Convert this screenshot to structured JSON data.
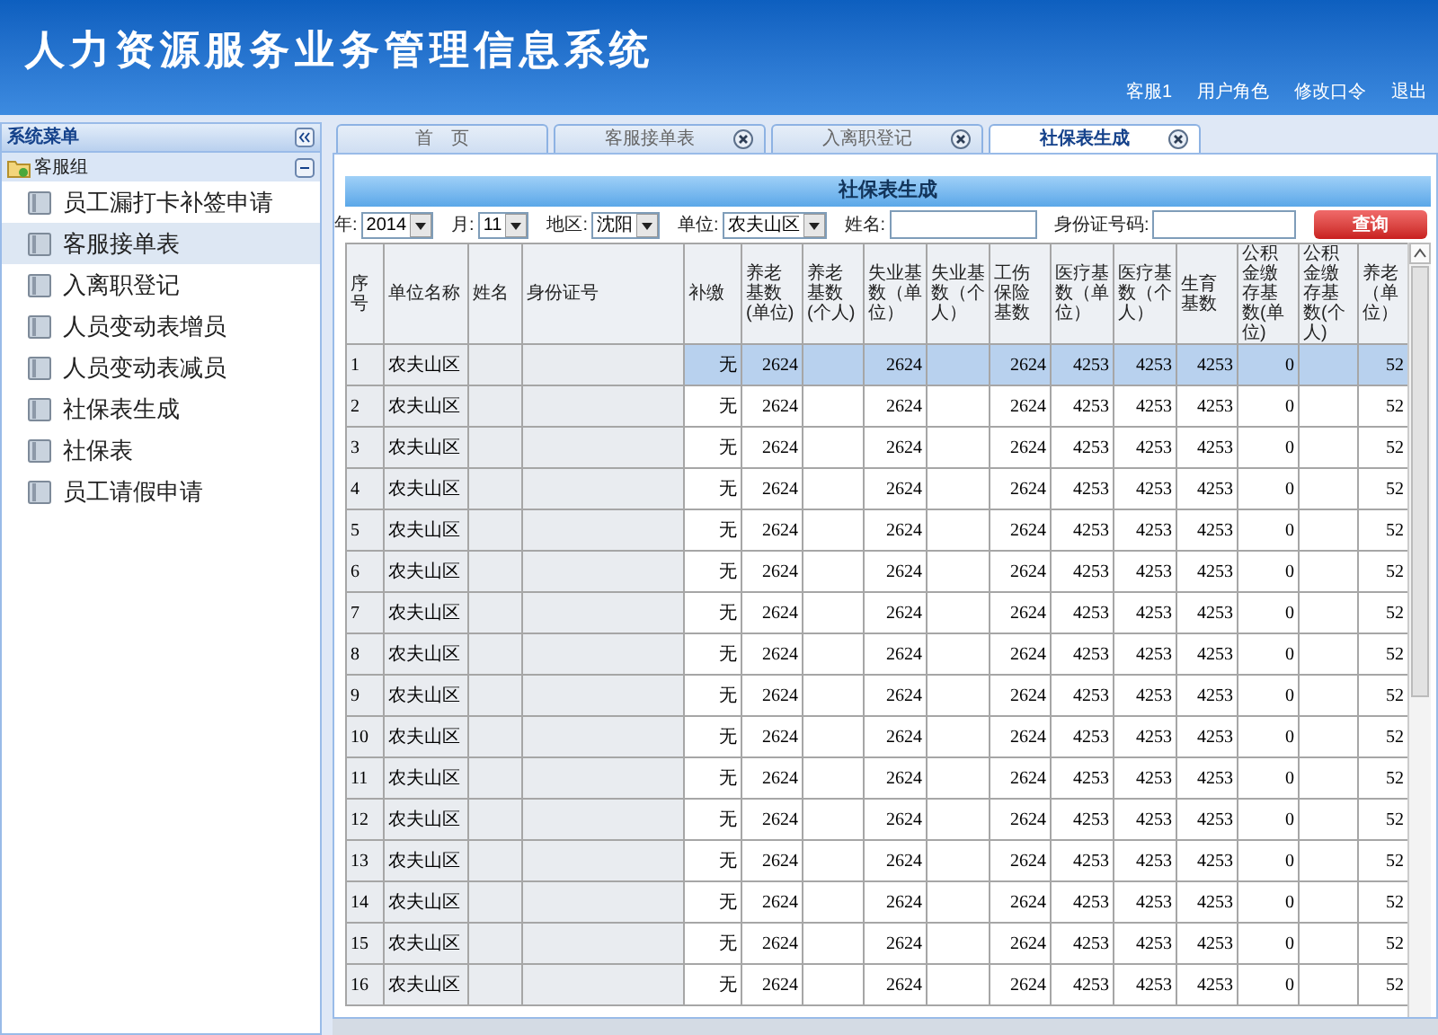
{
  "header": {
    "title": "人力资源服务业务管理信息系统",
    "links": [
      "客服1",
      "用户角色",
      "修改口令",
      "退出"
    ]
  },
  "sidebar": {
    "title": "系统菜单",
    "group": {
      "label": "客服组",
      "expanded": true,
      "items": [
        {
          "label": "员工漏打卡补签申请",
          "selected": false
        },
        {
          "label": "客服接单表",
          "selected": true
        },
        {
          "label": "入离职登记",
          "selected": false
        },
        {
          "label": "人员变动表增员",
          "selected": false
        },
        {
          "label": "人员变动表减员",
          "selected": false
        },
        {
          "label": "社保表生成",
          "selected": false
        },
        {
          "label": "社保表",
          "selected": false
        },
        {
          "label": "员工请假申请",
          "selected": false
        }
      ]
    }
  },
  "tabs": [
    {
      "label": "首　页",
      "selected": false,
      "closable": false
    },
    {
      "label": "客服接单表",
      "selected": false,
      "closable": true
    },
    {
      "label": "入离职登记",
      "selected": false,
      "closable": true
    },
    {
      "label": "社保表生成",
      "selected": true,
      "closable": true
    }
  ],
  "panel": {
    "title": "社保表生成",
    "filters": [
      {
        "kind": "select",
        "label": "年:",
        "value": "2014"
      },
      {
        "kind": "select",
        "label": "月:",
        "value": "11"
      },
      {
        "kind": "select",
        "label": "地区:",
        "value": "沈阳"
      },
      {
        "kind": "select",
        "label": "单位:",
        "value": "农夫山区"
      },
      {
        "kind": "input",
        "label": "姓名:"
      },
      {
        "kind": "input",
        "label": "身份证号码:"
      }
    ],
    "search_button": "查询"
  },
  "table": {
    "columns": [
      {
        "label": "序号",
        "kind": "index"
      },
      {
        "label": "单位名称",
        "kind": "label"
      },
      {
        "label": "姓名",
        "kind": "label"
      },
      {
        "label": "身份证号",
        "kind": "label"
      },
      {
        "label": "补缴",
        "kind": "flag"
      },
      {
        "label": "养老基数(单位)",
        "kind": "number"
      },
      {
        "label": "养老基数(个人)",
        "kind": "number"
      },
      {
        "label": "失业基数（单位）",
        "kind": "number"
      },
      {
        "label": "失业基数（个人）",
        "kind": "number"
      },
      {
        "label": "工伤保险基数",
        "kind": "number"
      },
      {
        "label": "医疗基数（单位）",
        "kind": "number"
      },
      {
        "label": "医疗基数（个人）",
        "kind": "number"
      },
      {
        "label": "生育基数",
        "kind": "number"
      },
      {
        "label": "公积金缴存基数(单位)",
        "kind": "number"
      },
      {
        "label": "公积金缴存基数(个人)",
        "kind": "number"
      },
      {
        "label": "养老（单位）",
        "kind": "number"
      }
    ],
    "rows": [
      {
        "selected": true,
        "cells": [
          "1",
          "农夫山区",
          null,
          null,
          "无",
          "2624",
          null,
          "2624",
          null,
          "2624",
          "4253",
          "4253",
          "4253",
          "0",
          null,
          "52"
        ]
      },
      {
        "selected": false,
        "cells": [
          "2",
          "农夫山区",
          null,
          null,
          "无",
          "2624",
          null,
          "2624",
          null,
          "2624",
          "4253",
          "4253",
          "4253",
          "0",
          null,
          "52"
        ]
      },
      {
        "selected": false,
        "cells": [
          "3",
          "农夫山区",
          null,
          null,
          "无",
          "2624",
          null,
          "2624",
          null,
          "2624",
          "4253",
          "4253",
          "4253",
          "0",
          null,
          "52"
        ]
      },
      {
        "selected": false,
        "cells": [
          "4",
          "农夫山区",
          null,
          null,
          "无",
          "2624",
          null,
          "2624",
          null,
          "2624",
          "4253",
          "4253",
          "4253",
          "0",
          null,
          "52"
        ]
      },
      {
        "selected": false,
        "cells": [
          "5",
          "农夫山区",
          null,
          null,
          "无",
          "2624",
          null,
          "2624",
          null,
          "2624",
          "4253",
          "4253",
          "4253",
          "0",
          null,
          "52"
        ]
      },
      {
        "selected": false,
        "cells": [
          "6",
          "农夫山区",
          null,
          null,
          "无",
          "2624",
          null,
          "2624",
          null,
          "2624",
          "4253",
          "4253",
          "4253",
          "0",
          null,
          "52"
        ]
      },
      {
        "selected": false,
        "cells": [
          "7",
          "农夫山区",
          null,
          null,
          "无",
          "2624",
          null,
          "2624",
          null,
          "2624",
          "4253",
          "4253",
          "4253",
          "0",
          null,
          "52"
        ]
      },
      {
        "selected": false,
        "cells": [
          "8",
          "农夫山区",
          null,
          null,
          "无",
          "2624",
          null,
          "2624",
          null,
          "2624",
          "4253",
          "4253",
          "4253",
          "0",
          null,
          "52"
        ]
      },
      {
        "selected": false,
        "cells": [
          "9",
          "农夫山区",
          null,
          null,
          "无",
          "2624",
          null,
          "2624",
          null,
          "2624",
          "4253",
          "4253",
          "4253",
          "0",
          null,
          "52"
        ]
      },
      {
        "selected": false,
        "cells": [
          "10",
          "农夫山区",
          null,
          null,
          "无",
          "2624",
          null,
          "2624",
          null,
          "2624",
          "4253",
          "4253",
          "4253",
          "0",
          null,
          "52"
        ]
      },
      {
        "selected": false,
        "cells": [
          "11",
          "农夫山区",
          null,
          null,
          "无",
          "2624",
          null,
          "2624",
          null,
          "2624",
          "4253",
          "4253",
          "4253",
          "0",
          null,
          "52"
        ]
      },
      {
        "selected": false,
        "cells": [
          "12",
          "农夫山区",
          null,
          null,
          "无",
          "2624",
          null,
          "2624",
          null,
          "2624",
          "4253",
          "4253",
          "4253",
          "0",
          null,
          "52"
        ]
      },
      {
        "selected": false,
        "cells": [
          "13",
          "农夫山区",
          null,
          null,
          "无",
          "2624",
          null,
          "2624",
          null,
          "2624",
          "4253",
          "4253",
          "4253",
          "0",
          null,
          "52"
        ]
      },
      {
        "selected": false,
        "cells": [
          "14",
          "农夫山区",
          null,
          null,
          "无",
          "2624",
          null,
          "2624",
          null,
          "2624",
          "4253",
          "4253",
          "4253",
          "0",
          null,
          "52"
        ]
      },
      {
        "selected": false,
        "cells": [
          "15",
          "农夫山区",
          null,
          null,
          "无",
          "2624",
          null,
          "2624",
          null,
          "2624",
          "4253",
          "4253",
          "4253",
          "0",
          null,
          "52"
        ]
      },
      {
        "selected": false,
        "cells": [
          "16",
          "农夫山区",
          null,
          null,
          "无",
          "2624",
          null,
          "2624",
          null,
          "2624",
          "4253",
          "4253",
          "4253",
          "0",
          null,
          "52"
        ]
      }
    ]
  }
}
